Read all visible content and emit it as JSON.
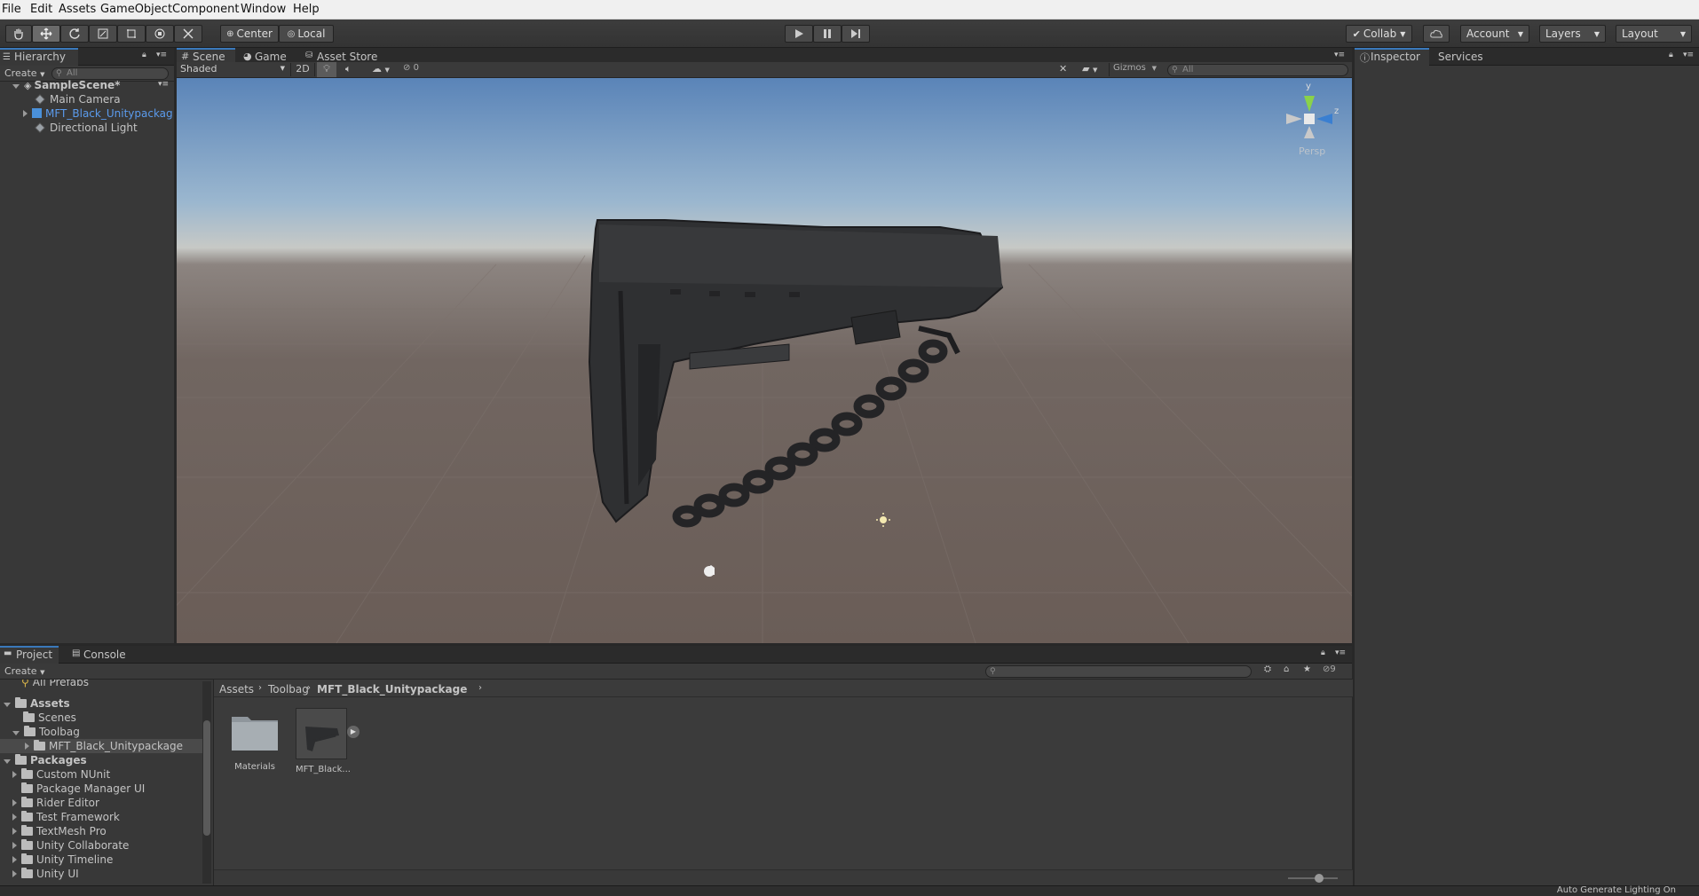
{
  "menu": [
    "File",
    "Edit",
    "Assets",
    "GameObject",
    "Component",
    "Window",
    "Help"
  ],
  "toolbar": {
    "pivot_label": "Center",
    "space_label": "Local",
    "collab_label": "Collab",
    "account_label": "Account",
    "layers_label": "Layers",
    "layout_label": "Layout"
  },
  "hierarchy": {
    "tab": "Hierarchy",
    "create": "Create",
    "search_placeholder": "All",
    "scene": "SampleScene*",
    "items": [
      "Main Camera",
      "MFT_Black_Unitypackag",
      "Directional Light"
    ]
  },
  "scene_tabs": [
    "Scene",
    "Game",
    "Asset Store"
  ],
  "scene_bar": {
    "shading": "Shaded",
    "mode2d": "2D",
    "hidden_count": "0",
    "gizmos": "Gizmos",
    "search_placeholder": "All"
  },
  "gizmo": {
    "y": "y",
    "z": "z",
    "persp": "Persp"
  },
  "inspector": {
    "tabs": [
      "Inspector",
      "Services"
    ]
  },
  "project": {
    "tabs": [
      "Project",
      "Console"
    ],
    "create": "Create",
    "hidden_count": "9",
    "tree": {
      "all_prefabs": "All Prefabs",
      "assets": "Assets",
      "scenes": "Scenes",
      "toolbag": "Toolbag",
      "mft": "MFT_Black_Unitypackage",
      "packages": "Packages",
      "package_items": [
        "Custom NUnit",
        "Package Manager UI",
        "Rider Editor",
        "Test Framework",
        "TextMesh Pro",
        "Unity Collaborate",
        "Unity Timeline",
        "Unity UI"
      ]
    },
    "breadcrumb": [
      "Assets",
      "Toolbag",
      "MFT_Black_Unitypackage"
    ],
    "files": [
      "Materials",
      "MFT_Black..."
    ]
  },
  "status": {
    "text": "Auto Generate Lighting On"
  },
  "colors": {
    "accent": "#3a79bb",
    "selected_text": "#5b9bed"
  }
}
